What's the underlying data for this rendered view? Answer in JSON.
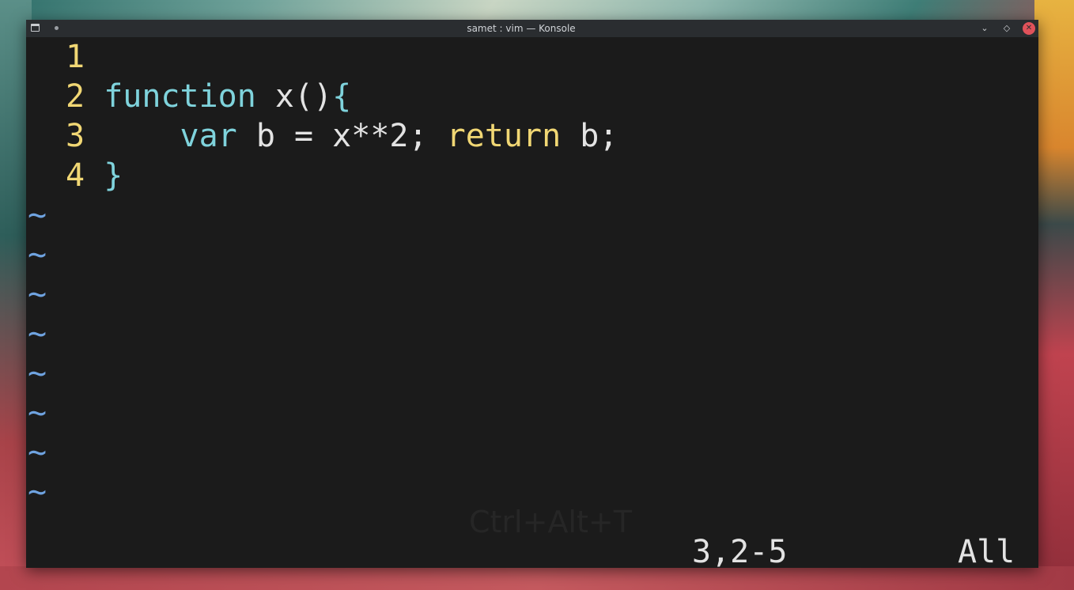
{
  "window": {
    "title": "samet : vim — Konsole",
    "buttons": {
      "minimize": "⌄",
      "maximize": "◇",
      "close": "✕"
    }
  },
  "editor": {
    "lines": [
      {
        "number": "1",
        "segments": []
      },
      {
        "number": "2",
        "segments": [
          "function",
          " x()",
          "{"
        ]
      },
      {
        "number": "3",
        "segments": [
          "    ",
          "var",
          " b = x**2; ",
          "return",
          " b;"
        ]
      },
      {
        "number": "4",
        "segments": [
          "}"
        ]
      }
    ],
    "tilde": "~",
    "ghost_text": "Ctrl+Alt+T"
  },
  "status": {
    "position": "3,2-5",
    "scroll": "All"
  },
  "colors": {
    "line_number": "#f1d774",
    "keyword_blue": "#7fd3dc",
    "keyword_yellow": "#f1d774",
    "text": "#e3e3e3",
    "tilde": "#6fa3e0",
    "background": "#1b1b1b"
  }
}
